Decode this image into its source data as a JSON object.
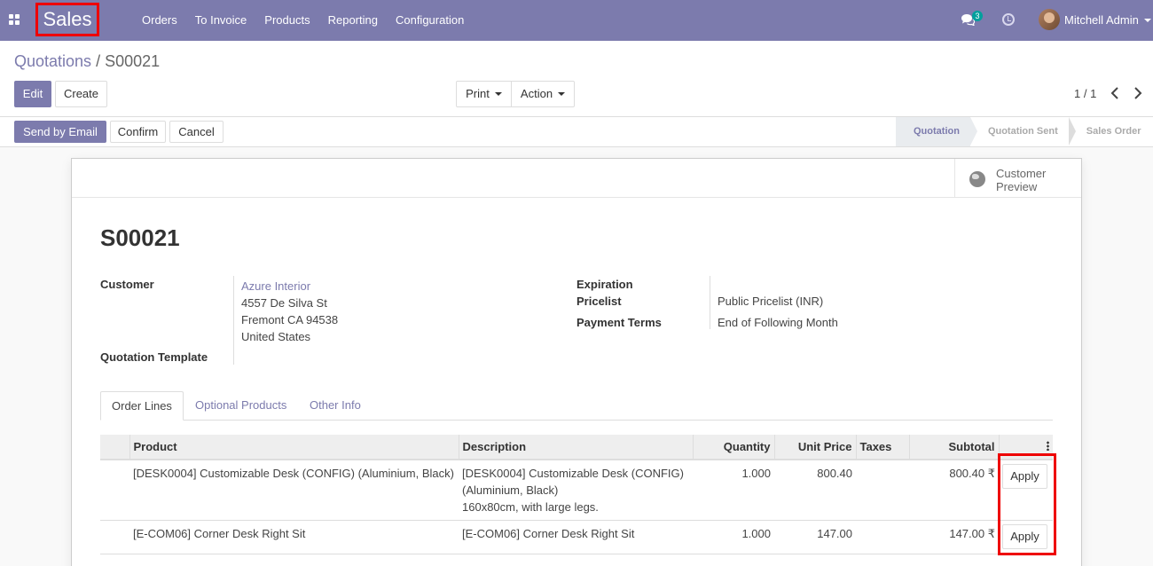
{
  "navbar": {
    "app_name": "Sales",
    "menu": [
      "Orders",
      "To Invoice",
      "Products",
      "Reporting",
      "Configuration"
    ],
    "chat_count": "3",
    "user_name": "Mitchell Admin",
    "icons": [
      "apps-icon",
      "chat-icon",
      "clock-icon",
      "avatar"
    ]
  },
  "breadcrumb": {
    "parent": "Quotations",
    "separator": "/",
    "current": "S00021"
  },
  "toolbar": {
    "edit": "Edit",
    "create": "Create",
    "print": "Print",
    "action": "Action"
  },
  "pager": {
    "text": "1 / 1"
  },
  "statusbar": {
    "send_email": "Send by Email",
    "confirm": "Confirm",
    "cancel": "Cancel",
    "stages": [
      {
        "label": "Quotation",
        "active": true
      },
      {
        "label": "Quotation Sent",
        "active": false
      },
      {
        "label": "Sales Order",
        "active": false
      }
    ]
  },
  "smart_button": {
    "line1": "Customer",
    "line2": "Preview"
  },
  "form": {
    "title": "S00021",
    "customer_label": "Customer",
    "customer_name": "Azure Interior",
    "customer_address": [
      "4557 De Silva St",
      "Fremont CA 94538",
      "United States"
    ],
    "template_label": "Quotation Template",
    "expiration_label": "Expiration",
    "pricelist_label": "Pricelist",
    "pricelist_value": "Public Pricelist (INR)",
    "payment_terms_label": "Payment Terms",
    "payment_terms_value": "End of Following Month"
  },
  "tabs": [
    {
      "label": "Order Lines",
      "active": true
    },
    {
      "label": "Optional Products",
      "active": false
    },
    {
      "label": "Other Info",
      "active": false
    }
  ],
  "table": {
    "headers": [
      "Product",
      "Description",
      "Quantity",
      "Unit Price",
      "Taxes",
      "Subtotal"
    ],
    "rows": [
      {
        "product": "[DESK0004] Customizable Desk (CONFIG) (Aluminium, Black)",
        "description": [
          "[DESK0004] Customizable Desk (CONFIG)",
          "(Aluminium, Black)",
          "160x80cm, with large legs."
        ],
        "quantity": "1.000",
        "unit_price": "800.40",
        "taxes": "",
        "subtotal": "800.40 ₹",
        "button": "Apply"
      },
      {
        "product": "[E-COM06] Corner Desk Right Sit",
        "description": [
          "[E-COM06] Corner Desk Right Sit"
        ],
        "quantity": "1.000",
        "unit_price": "147.00",
        "taxes": "",
        "subtotal": "147.00 ₹",
        "button": "Apply"
      }
    ]
  },
  "colors": {
    "brand": "#7c7bad",
    "highlight": "#ee0000",
    "teal_badge": "#00a09d"
  }
}
